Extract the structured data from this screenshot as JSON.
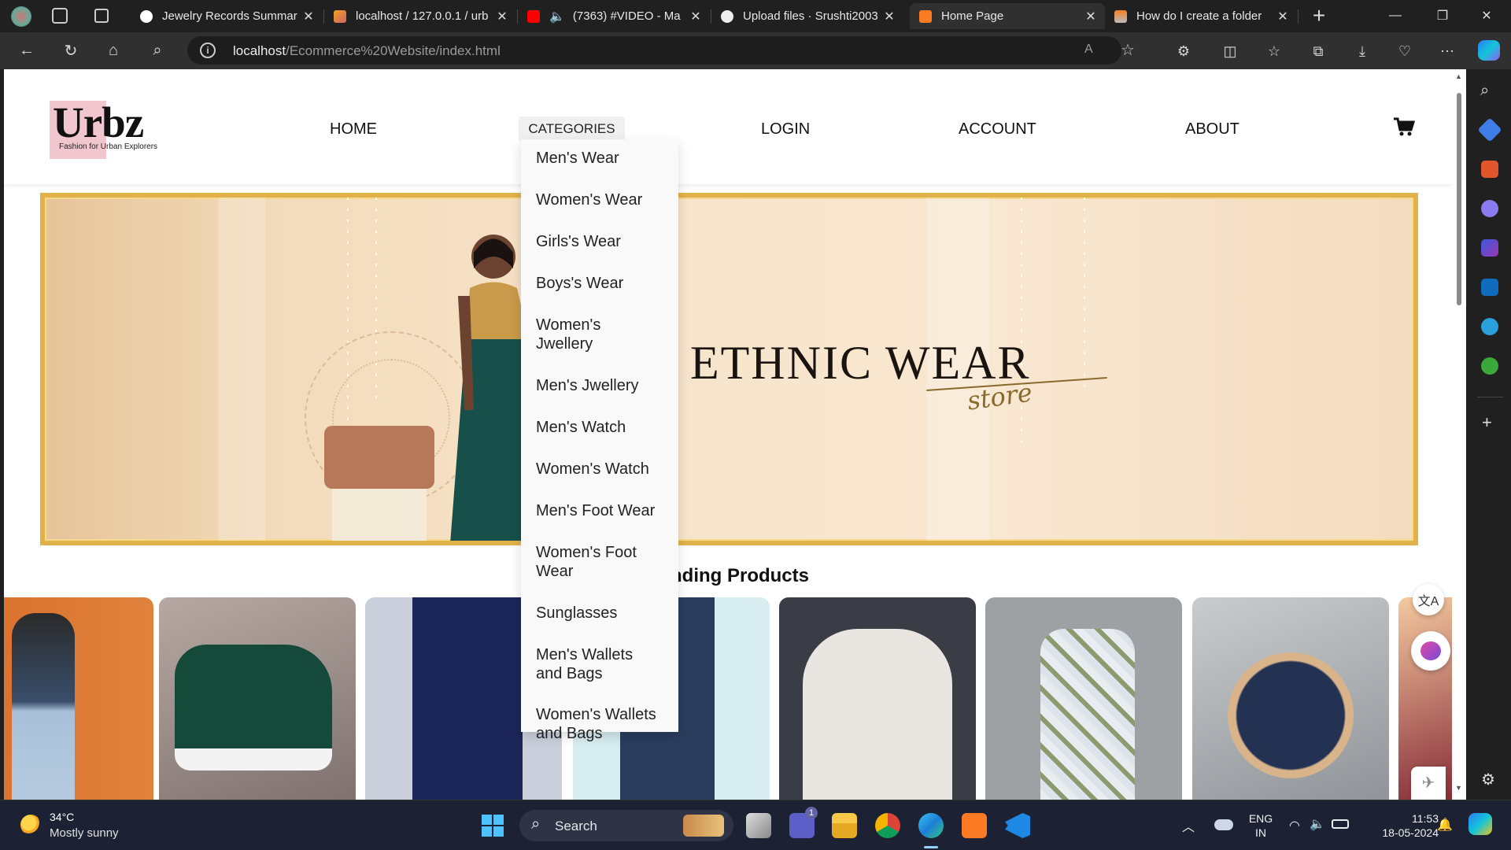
{
  "browser": {
    "tabs": [
      {
        "title": "Jewelry Records Summar",
        "active": false,
        "icon": "openai-icon"
      },
      {
        "title": "localhost / 127.0.0.1 / urb",
        "active": false,
        "icon": "phpmyadmin-icon"
      },
      {
        "title": "(7363) #VIDEO - Ma",
        "active": false,
        "icon": "youtube-icon"
      },
      {
        "title": "Upload files · Srushti2003",
        "active": false,
        "icon": "github-icon"
      },
      {
        "title": "Home Page",
        "active": true,
        "icon": "xampp-icon"
      },
      {
        "title": "How do I create a folder",
        "active": false,
        "icon": "stackoverflow-icon"
      }
    ],
    "new_tab": "+",
    "url_host": "localhost",
    "url_path": "/Ecommerce%20Website/index.html"
  },
  "site": {
    "logo": "Urbz",
    "tagline": "Fashion for Urban Explorers",
    "nav": {
      "home": "HOME",
      "categories": "CATEGORIES",
      "login": "LOGIN",
      "account": "ACCOUNT",
      "about": "ABOUT"
    },
    "categories_menu": [
      "Men's Wear",
      "Women's Wear",
      "Girls's Wear",
      "Boys's Wear",
      "Women's Jwellery",
      "Men's Jwellery",
      "Men's Watch",
      "Women's Watch",
      "Men's Foot Wear",
      "Women's Foot Wear",
      "Sunglasses",
      "Men's Wallets and Bags",
      "Women's Wallets and Bags"
    ],
    "banner": {
      "title": "ETHNIC WEAR",
      "subtitle": "store"
    },
    "trending_title": "Trending Products",
    "trending_visible": "nding Products"
  },
  "taskbar": {
    "temperature": "34°C",
    "weather": "Mostly sunny",
    "search": "Search",
    "lang_top": "ENG",
    "lang_bottom": "IN",
    "time": "11:53",
    "date": "18-05-2024",
    "teams_badge": "1"
  },
  "colors": {
    "accent_gold": "#e2b24a",
    "logo_pink": "#f2c6cf"
  }
}
